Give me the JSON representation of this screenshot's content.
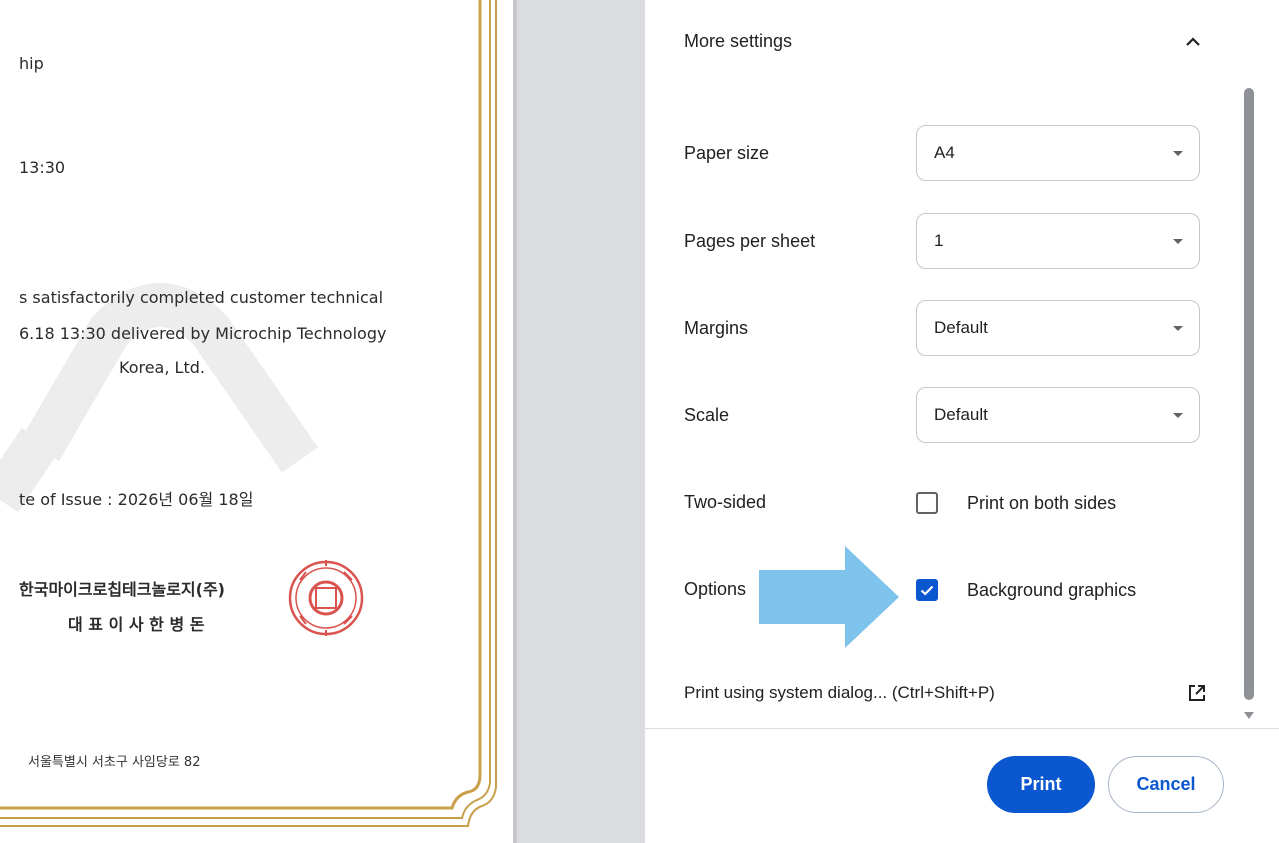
{
  "preview": {
    "certificate": {
      "line_ship": "hip",
      "line_time": "13:30",
      "body_line1": "s satisfactorily completed customer technical",
      "body_line2": "6.18 13:30 delivered by Microchip Technology",
      "body_line3": "Korea, Ltd.",
      "issue_date": "te of Issue : 2026년 06월 18일",
      "company_kr": "한국마이크로칩테크놀로지(주)",
      "ceo_kr": "대 표 이 사   한  병  돈",
      "address_kr": "서울특별시 서초구 사임당로 82",
      "frame_color": "#c9a04a",
      "seal_color": "#d9534f"
    }
  },
  "settings": {
    "section_title": "More settings",
    "rows": {
      "paper_size": {
        "label": "Paper size",
        "value": "A4"
      },
      "pages_per_sheet": {
        "label": "Pages per sheet",
        "value": "1"
      },
      "margins": {
        "label": "Margins",
        "value": "Default"
      },
      "scale": {
        "label": "Scale",
        "value": "Default"
      },
      "two_sided": {
        "label": "Two-sided",
        "option": "Print on both sides",
        "checked": false
      },
      "options": {
        "label": "Options",
        "option": "Background graphics",
        "checked": true
      }
    },
    "system_dialog": "Print using system dialog... (Ctrl+Shift+P)"
  },
  "footer": {
    "print_label": "Print",
    "cancel_label": "Cancel"
  },
  "icons": {
    "collapse": "chevron-up-icon",
    "dropdown": "caret-down-icon",
    "external": "open-in-new-icon",
    "check": "check-icon"
  },
  "colors": {
    "accent": "#0b57d0",
    "annotation_arrow": "#7ec3ec"
  }
}
